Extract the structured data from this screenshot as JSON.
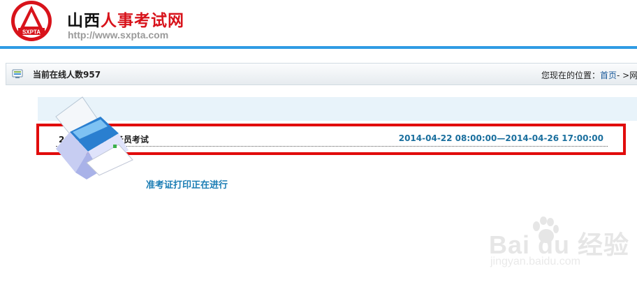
{
  "header": {
    "logo_text": "SXPTA",
    "site_name_part1": "山西",
    "site_name_part2": "人事考试网",
    "site_url": "http://www.sxpta.com",
    "accent_color": "#d8131b",
    "rule_color": "#2f9be4"
  },
  "status_bar": {
    "online_label": "当前在线人数957",
    "location_label": "您现在的位置：",
    "home_link": "首页",
    "breadcrumb_rest": "- >网"
  },
  "exam": {
    "name": "20  西省录用公务员考试",
    "time_range": "2014-04-22 08:00:00—2014-04-26 17:00:00"
  },
  "print_status": "准考证打印正在进行",
  "watermark": {
    "brand": "Bai du 经验",
    "url": "jingyan.baidu.com"
  }
}
